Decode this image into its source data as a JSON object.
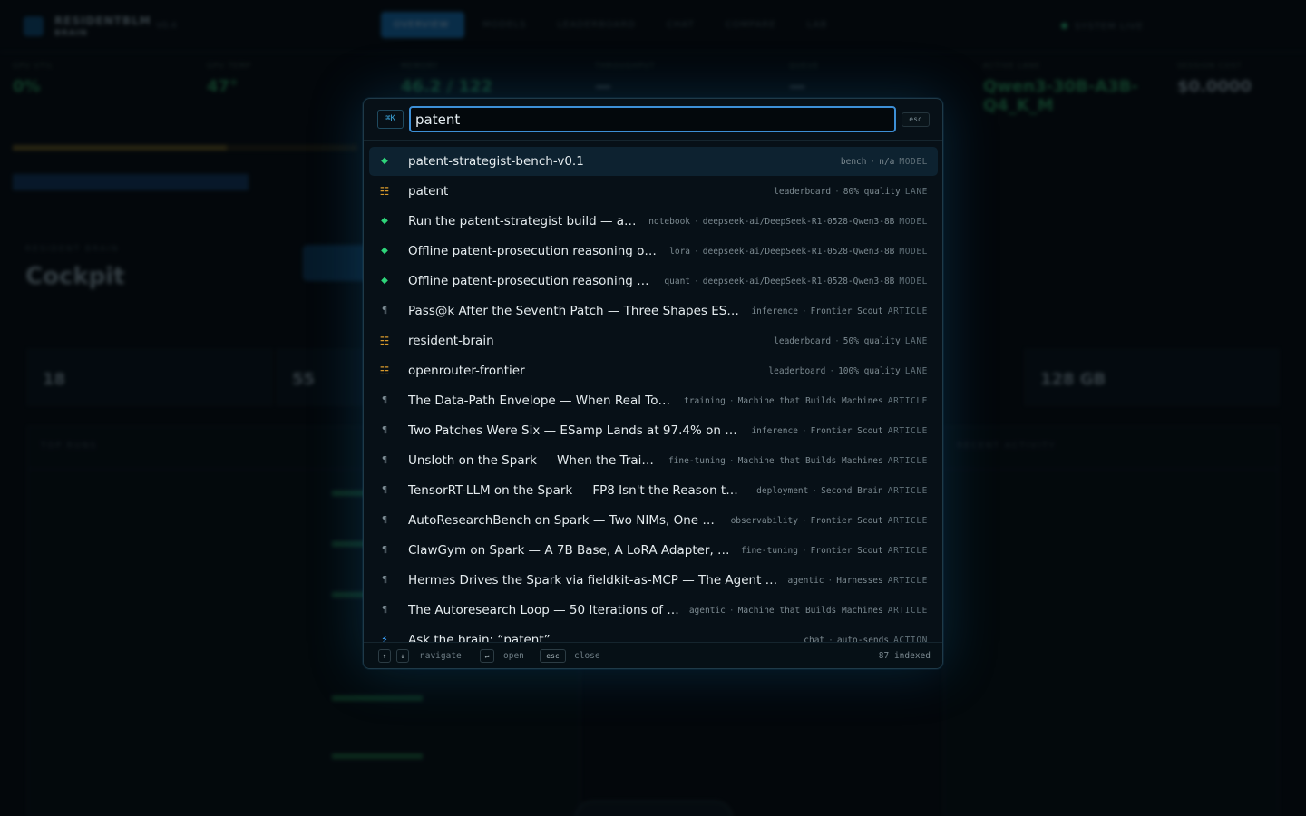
{
  "background": {
    "brand": {
      "name_line1": "RESIDENTBLM",
      "name_line2": "BRAIN",
      "version": "V0.4"
    },
    "nav": [
      "OVERVIEW",
      "MODELS",
      "LEADERBOARD",
      "CHAT",
      "COMPARE",
      "LAB"
    ],
    "system_status": "SYSTEM LIVE",
    "stats": [
      {
        "label": "GPU UTIL",
        "value": "0%",
        "color": "#2a9c5e"
      },
      {
        "label": "GPU TEMP",
        "value": "47°",
        "color": "#2a9c5e"
      },
      {
        "label": "MEMORY",
        "value": "46.2 / 122",
        "color": "#2a9c5e"
      },
      {
        "label": "THROUGHPUT",
        "value": "—",
        "color": "#6d7f88"
      },
      {
        "label": "QUEUE",
        "value": "—",
        "color": "#6d7f88"
      },
      {
        "label": "ACTIVE LANE",
        "value": "Qwen3-30B-A3B-Q4_K_M",
        "color": "#2a9c5e"
      },
      {
        "label": "SESSION COST",
        "value": "$0.0000",
        "color": "#8ca0aa"
      }
    ],
    "section_kicker": "RESIDENT BRAIN",
    "section_title": "Cockpit",
    "kpis": [
      {
        "value": "18"
      },
      {
        "value": "55"
      },
      {
        "value": "128 GB"
      }
    ],
    "panel_titles": {
      "left": "TOP RUNS",
      "right": "RECENT ACTIVITY"
    }
  },
  "palette": {
    "shortcut_hint": "⌘K",
    "query": "patent",
    "esc_label": "esc",
    "results": [
      {
        "icon": "◆",
        "icon_type": "model",
        "title": "patent-strategist-bench-v0.1",
        "meta": [
          "bench",
          "n/a"
        ],
        "kind": "MODEL",
        "selected": true
      },
      {
        "icon": "☷",
        "icon_type": "lane",
        "title": "patent",
        "meta": [
          "leaderboard",
          "80% quality"
        ],
        "kind": "LANE"
      },
      {
        "icon": "◆",
        "icon_type": "model",
        "title": "Run the patent-strategist build — a…",
        "meta": [
          "notebook",
          "deepseek-ai/DeepSeek-R1-0528-Qwen3-8B"
        ],
        "kind": "MODEL"
      },
      {
        "icon": "◆",
        "icon_type": "model",
        "title": "Offline patent-prosecution reasoning o…",
        "meta": [
          "lora",
          "deepseek-ai/DeepSeek-R1-0528-Qwen3-8B"
        ],
        "kind": "MODEL"
      },
      {
        "icon": "◆",
        "icon_type": "model",
        "title": "Offline patent-prosecution reasoning …",
        "meta": [
          "quant",
          "deepseek-ai/DeepSeek-R1-0528-Qwen3-8B"
        ],
        "kind": "MODEL"
      },
      {
        "icon": "¶",
        "icon_type": "article",
        "title": "Pass@k After the Seventh Patch — Three Shapes ES…",
        "meta": [
          "inference",
          "Frontier Scout"
        ],
        "kind": "ARTICLE"
      },
      {
        "icon": "☷",
        "icon_type": "lane",
        "title": "resident-brain",
        "meta": [
          "leaderboard",
          "50% quality"
        ],
        "kind": "LANE"
      },
      {
        "icon": "☷",
        "icon_type": "lane",
        "title": "openrouter-frontier",
        "meta": [
          "leaderboard",
          "100% quality"
        ],
        "kind": "LANE"
      },
      {
        "icon": "¶",
        "icon_type": "article",
        "title": "The Data-Path Envelope — When Real To…",
        "meta": [
          "training",
          "Machine that Builds Machines"
        ],
        "kind": "ARTICLE"
      },
      {
        "icon": "¶",
        "icon_type": "article",
        "title": "Two Patches Were Six — ESamp Lands at 97.4% on a…",
        "meta": [
          "inference",
          "Frontier Scout"
        ],
        "kind": "ARTICLE"
      },
      {
        "icon": "¶",
        "icon_type": "article",
        "title": "Unsloth on the Spark — When the Trai…",
        "meta": [
          "fine-tuning",
          "Machine that Builds Machines"
        ],
        "kind": "ARTICLE"
      },
      {
        "icon": "¶",
        "icon_type": "article",
        "title": "TensorRT-LLM on the Spark — FP8 Isn't the Reason t…",
        "meta": [
          "deployment",
          "Second Brain"
        ],
        "kind": "ARTICLE"
      },
      {
        "icon": "¶",
        "icon_type": "article",
        "title": "AutoResearchBench on Spark — Two NIMs, One …",
        "meta": [
          "observability",
          "Frontier Scout"
        ],
        "kind": "ARTICLE"
      },
      {
        "icon": "¶",
        "icon_type": "article",
        "title": "ClawGym on Spark — A 7B Base, A LoRA Adapter, a…",
        "meta": [
          "fine-tuning",
          "Frontier Scout"
        ],
        "kind": "ARTICLE"
      },
      {
        "icon": "¶",
        "icon_type": "article",
        "title": "Hermes Drives the Spark via fieldkit-as-MCP — The Agent …",
        "meta": [
          "agentic",
          "Harnesses"
        ],
        "kind": "ARTICLE"
      },
      {
        "icon": "¶",
        "icon_type": "article",
        "title": "The Autoresearch Loop — 50 Iterations of …",
        "meta": [
          "agentic",
          "Machine that Builds Machines"
        ],
        "kind": "ARTICLE"
      },
      {
        "icon": "⚡",
        "icon_type": "action",
        "title": "Ask the brain: “patent”",
        "meta": [
          "chat",
          "auto-sends"
        ],
        "kind": "ACTION"
      }
    ],
    "footer": {
      "up_key": "↑",
      "down_key": "↓",
      "navigate_label": "navigate",
      "enter_key": "↵",
      "open_label": "open",
      "esc_key": "esc",
      "close_label": "close",
      "indexed_label": "87 indexed"
    }
  }
}
